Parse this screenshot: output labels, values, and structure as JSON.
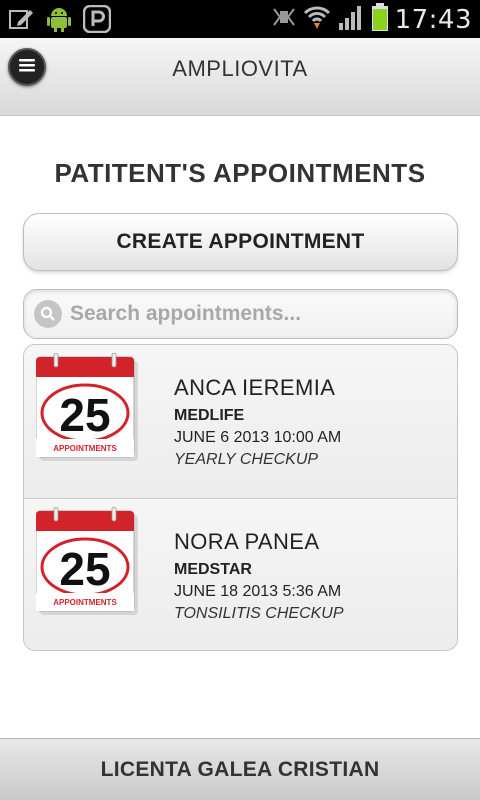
{
  "status_bar": {
    "time": "17:43",
    "left_icons": [
      "edit-icon",
      "android-icon",
      "p-app-icon"
    ],
    "right_icons": [
      "vibrate-icon",
      "wifi-icon",
      "signal-icon",
      "battery-icon"
    ],
    "battery_color": "#8bd320"
  },
  "header": {
    "title": "AMPLIOVITA",
    "menu_icon": "menu-icon"
  },
  "page": {
    "title": "PATITENT'S APPOINTMENTS",
    "create_button": "CREATE APPOINTMENT",
    "search": {
      "placeholder": "Search appointments...",
      "value": ""
    }
  },
  "appointments": [
    {
      "name": "ANCA IEREMIA",
      "clinic": "MEDLIFE",
      "datetime": "JUNE 6 2013 10:00 AM",
      "reason": "YEARLY CHECKUP",
      "icon_day": "25",
      "icon_label": "APPOINTMENTS"
    },
    {
      "name": "NORA PANEA",
      "clinic": "MEDSTAR",
      "datetime": "JUNE 18 2013 5:36 AM",
      "reason": "TONSILITIS CHECKUP",
      "icon_day": "25",
      "icon_label": "APPOINTMENTS"
    }
  ],
  "footer": {
    "text": "LICENTA GALEA CRISTIAN"
  },
  "colors": {
    "calendar_red": "#d3232a",
    "header_bg": "#e3e3e3",
    "text_dark": "#333333"
  }
}
